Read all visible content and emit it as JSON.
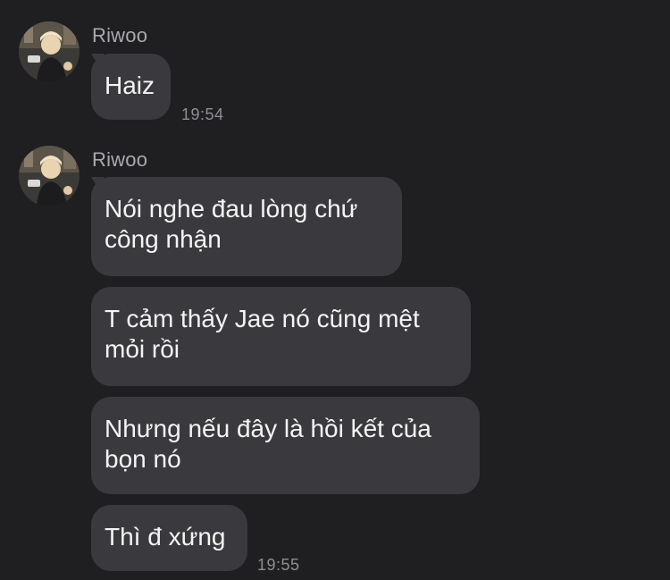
{
  "colors": {
    "background": "#1f1f22",
    "bubble": "#3a3a3e",
    "sender_name": "#a9a9ae",
    "timestamp": "#8e8e93",
    "text": "#f4f4f4"
  },
  "groups": [
    {
      "sender": "Riwoo",
      "avatar_icon": "user-avatar",
      "messages": [
        {
          "text": "Haiz"
        }
      ],
      "time": "19:54"
    },
    {
      "sender": "Riwoo",
      "avatar_icon": "user-avatar",
      "messages": [
        {
          "text": "Nói nghe đau lòng chứ\ncông nhận"
        },
        {
          "text": "T cảm thấy Jae nó cũng mệt\nmỏi rồi"
        },
        {
          "text": "Nhưng nếu đây là hồi kết của\nbọn nó"
        },
        {
          "text": "Thì đ xứng"
        }
      ],
      "time": "19:55"
    }
  ]
}
